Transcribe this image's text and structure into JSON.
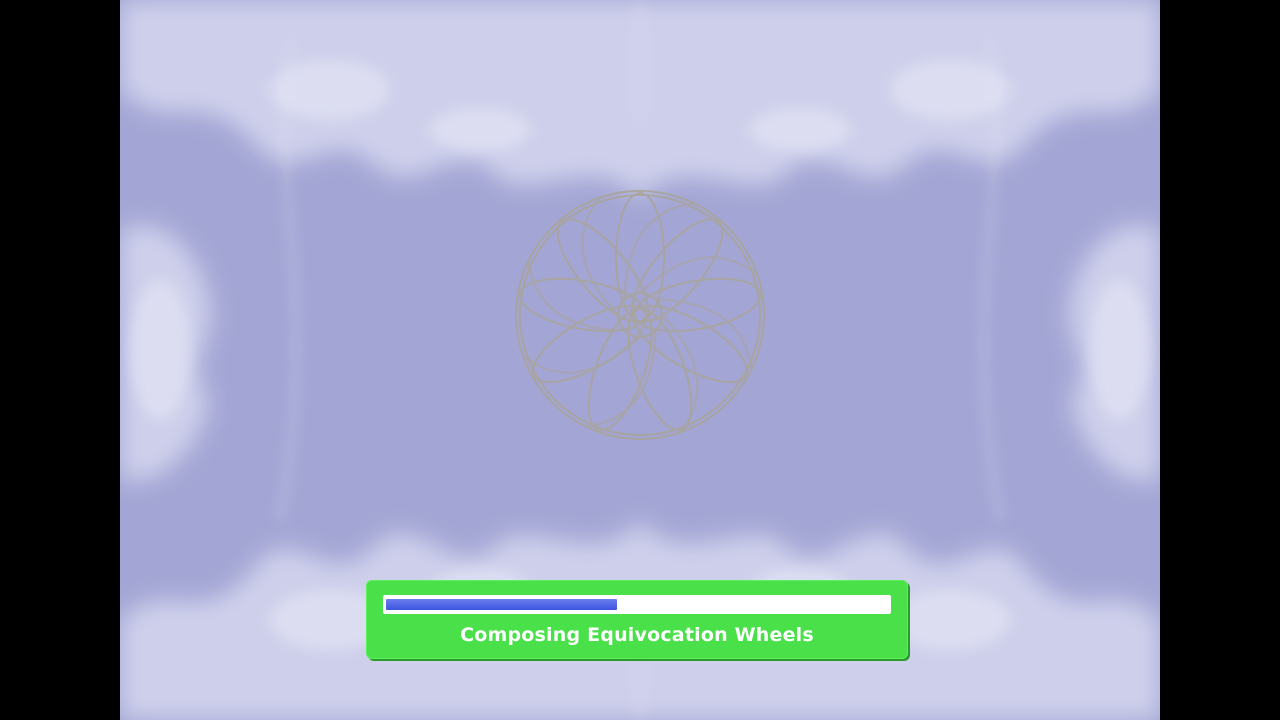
{
  "loading": {
    "progress": 0.46,
    "status_text": "Composing Equivocation Wheels"
  },
  "colors": {
    "background": "#a3a5d4",
    "pattern_light": "#d6d8f0",
    "panel": "#4ae04a",
    "progress_fill": "#3d54e0",
    "progress_track": "#ffffff",
    "wheel_stroke": "#a8a49a"
  },
  "icons": {
    "center_emblem": "rose-wheel-icon"
  }
}
